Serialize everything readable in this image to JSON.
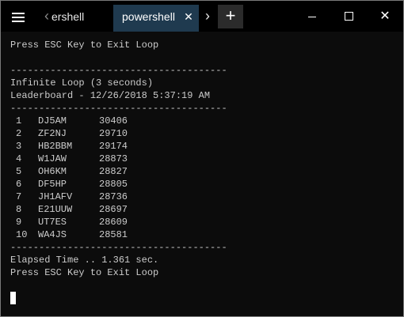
{
  "window": {
    "tabs": [
      {
        "label": "ershell",
        "active": false
      },
      {
        "label": "powershell",
        "active": true
      }
    ],
    "close_tab_glyph": "✕",
    "new_tab_glyph": "+",
    "scroll_left_glyph": "‹",
    "scroll_right_glyph": "›",
    "close_window_glyph": "✕",
    "icons": [
      "hamburger-menu-icon",
      "close-icon",
      "plus-icon",
      "chevron-left-icon",
      "chevron-right-icon",
      "minimize-icon",
      "maximize-icon"
    ],
    "colors": {
      "titlebar_bg": "#000000",
      "active_tab_bg": "#1f3a4f",
      "new_tab_bg": "#2b2b2b",
      "terminal_bg": "#0c0c0c",
      "terminal_text": "#cccccc"
    }
  },
  "terminal": {
    "exit_prompt_top": "Press ESC Key to Exit Loop",
    "separator_1": "--------------------------------------",
    "loop_title": "Infinite Loop (3 seconds)",
    "leaderboard_title": "Leaderboard - 12/26/2018 5:37:19 AM",
    "separator_2": "--------------------------------------",
    "leaderboard": [
      {
        "rank": "1",
        "call": "DJ5AM",
        "score": "30406"
      },
      {
        "rank": "2",
        "call": "ZF2NJ",
        "score": "29710"
      },
      {
        "rank": "3",
        "call": "HB2BBM",
        "score": "29174"
      },
      {
        "rank": "4",
        "call": "W1JAW",
        "score": "28873"
      },
      {
        "rank": "5",
        "call": "OH6KM",
        "score": "28827"
      },
      {
        "rank": "6",
        "call": "DF5HP",
        "score": "28805"
      },
      {
        "rank": "7",
        "call": "JH1AFV",
        "score": "28736"
      },
      {
        "rank": "8",
        "call": "E21UUW",
        "score": "28697"
      },
      {
        "rank": "9",
        "call": "UT7ES",
        "score": "28609"
      },
      {
        "rank": "10",
        "call": "WA4JS",
        "score": "28581"
      }
    ],
    "separator_3": "--------------------------------------",
    "elapsed": "Elapsed Time .. 1.361 sec.",
    "exit_prompt_bottom": "Press ESC Key to Exit Loop"
  }
}
